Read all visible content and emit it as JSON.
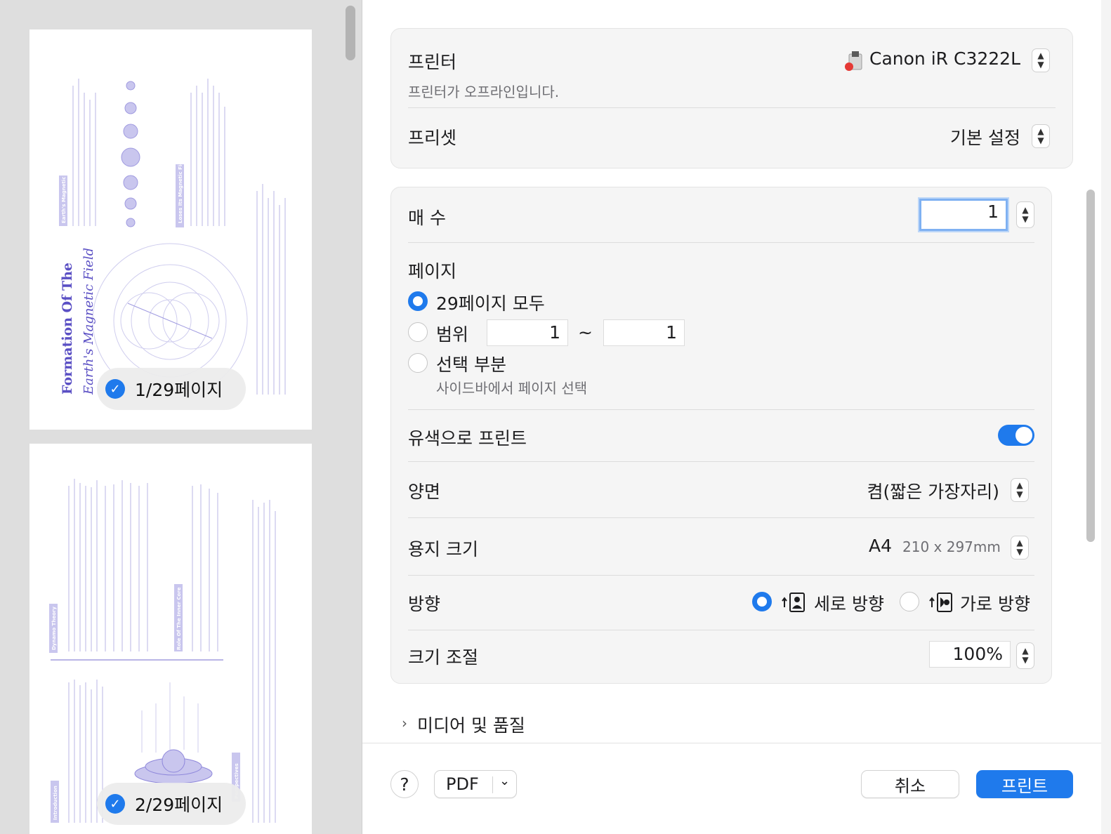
{
  "sidebar": {
    "pages": [
      {
        "badge": "1/29페이지",
        "title": "Formation Of The",
        "subtitle": "Earth's Magnetic Field",
        "section1": "Earth's Magnetic",
        "section2": "Loses Its Magnetic Field"
      },
      {
        "badge": "2/29페이지",
        "section1": "Dynamo Theory",
        "section2": "Role Of The Inner Core",
        "section3": "Introduction",
        "section4": "Perspectives"
      }
    ]
  },
  "printer": {
    "label": "프린터",
    "name": "Canon iR C3222L",
    "status": "프린터가 오프라인입니다."
  },
  "preset": {
    "label": "프리셋",
    "value": "기본 설정"
  },
  "copies": {
    "label": "매 수",
    "value": "1"
  },
  "pages": {
    "label": "페이지",
    "all": "29페이지 모두",
    "range": "범위",
    "range_from": "1",
    "range_sep": "~",
    "range_to": "1",
    "selection": "선택 부분",
    "selection_hint": "사이드바에서 페이지 선택"
  },
  "color": {
    "label": "유색으로 프린트",
    "on": true
  },
  "duplex": {
    "label": "양면",
    "value": "켬(짧은 가장자리)"
  },
  "paper": {
    "label": "용지 크기",
    "value": "A4",
    "dims": "210 x 297mm"
  },
  "orientation": {
    "label": "방향",
    "portrait": "세로 방향",
    "landscape": "가로 방향"
  },
  "scale": {
    "label": "크기 조절",
    "value": "100%"
  },
  "media": {
    "label": "미디어 및 품질"
  },
  "footer": {
    "help": "?",
    "pdf": "PDF",
    "cancel": "취소",
    "print": "프린트"
  },
  "colors": {
    "accent": "#1f7aec",
    "thumb_text": "#5a4fc4"
  }
}
